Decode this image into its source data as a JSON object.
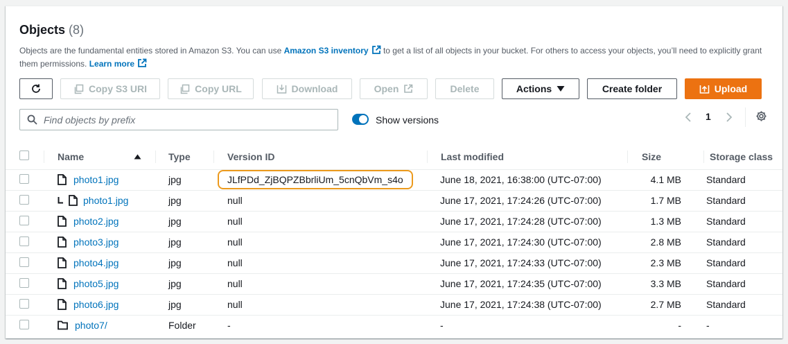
{
  "header": {
    "title": "Objects",
    "count": "(8)",
    "desc_1": "Objects are the fundamental entities stored in Amazon S3. You can use ",
    "inventory_link": "Amazon S3 inventory",
    "desc_2": " to get a list of all objects in your bucket. For others to access your objects, you’ll need to explicitly grant them permissions. ",
    "learn_more": "Learn more"
  },
  "toolbar": {
    "copy_uri": "Copy S3 URI",
    "copy_url": "Copy URL",
    "download": "Download",
    "open": "Open",
    "delete": "Delete",
    "actions": "Actions",
    "create_folder": "Create folder",
    "upload": "Upload"
  },
  "search": {
    "placeholder": "Find objects by prefix",
    "value": ""
  },
  "versions_toggle": {
    "label": "Show versions",
    "on": true
  },
  "pagination": {
    "page": "1"
  },
  "table": {
    "columns": {
      "name": "Name",
      "type": "Type",
      "version_id": "Version ID",
      "last_modified": "Last modified",
      "size": "Size",
      "storage_class": "Storage class"
    },
    "rows": [
      {
        "name": "photo1.jpg",
        "type": "jpg",
        "version_id": "JLfPDd_ZjBQPZBbrliUm_5cnQbVm_s4o",
        "last_modified": "June 18, 2021, 16:38:00 (UTC-07:00)",
        "size": "4.1 MB",
        "storage_class": "Standard"
      },
      {
        "name": "photo1.jpg",
        "type": "jpg",
        "version_id": "null",
        "last_modified": "June 17, 2021, 17:24:26 (UTC-07:00)",
        "size": "1.7 MB",
        "storage_class": "Standard"
      },
      {
        "name": "photo2.jpg",
        "type": "jpg",
        "version_id": "null",
        "last_modified": "June 17, 2021, 17:24:28 (UTC-07:00)",
        "size": "1.3 MB",
        "storage_class": "Standard"
      },
      {
        "name": "photo3.jpg",
        "type": "jpg",
        "version_id": "null",
        "last_modified": "June 17, 2021, 17:24:30 (UTC-07:00)",
        "size": "2.8 MB",
        "storage_class": "Standard"
      },
      {
        "name": "photo4.jpg",
        "type": "jpg",
        "version_id": "null",
        "last_modified": "June 17, 2021, 17:24:33 (UTC-07:00)",
        "size": "2.3 MB",
        "storage_class": "Standard"
      },
      {
        "name": "photo5.jpg",
        "type": "jpg",
        "version_id": "null",
        "last_modified": "June 17, 2021, 17:24:35 (UTC-07:00)",
        "size": "3.3 MB",
        "storage_class": "Standard"
      },
      {
        "name": "photo6.jpg",
        "type": "jpg",
        "version_id": "null",
        "last_modified": "June 17, 2021, 17:24:38 (UTC-07:00)",
        "size": "2.7 MB",
        "storage_class": "Standard"
      },
      {
        "name": "photo7/",
        "type": "Folder",
        "version_id": "-",
        "last_modified": "-",
        "size": "-",
        "storage_class": "-"
      }
    ]
  },
  "colors": {
    "link": "#0073bb",
    "primary": "#ec7211",
    "highlight": "#ec9a1d"
  }
}
